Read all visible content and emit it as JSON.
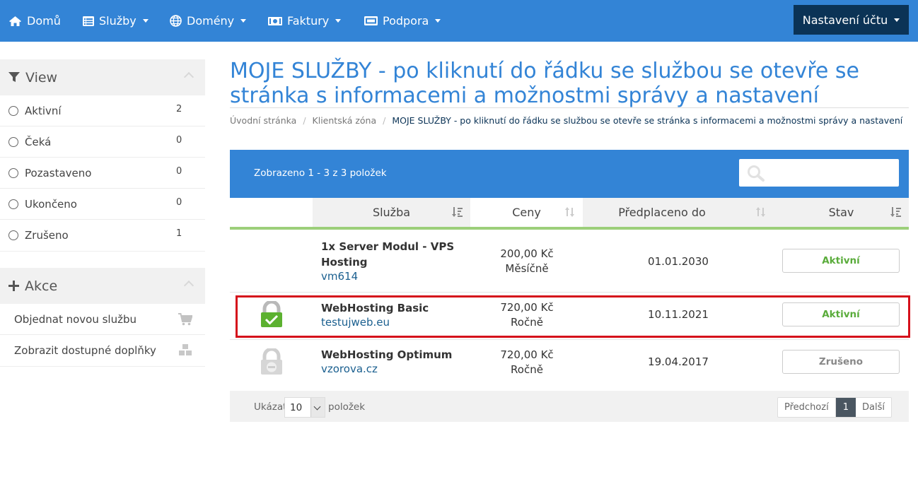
{
  "nav": {
    "home": "Domů",
    "services": "Služby",
    "domains": "Domény",
    "invoices": "Faktury",
    "support": "Podpora",
    "account": "Nastavení účtu"
  },
  "sidebar": {
    "view_title": "View",
    "filters": [
      {
        "label": "Aktivní",
        "count": "2"
      },
      {
        "label": "Čeká",
        "count": "0"
      },
      {
        "label": "Pozastaveno",
        "count": "0"
      },
      {
        "label": "Ukončeno",
        "count": "0"
      },
      {
        "label": "Zrušeno",
        "count": "1"
      }
    ],
    "actions_title": "Akce",
    "actions": [
      {
        "label": "Objednat novou službu",
        "icon": "cart-icon"
      },
      {
        "label": "Zobrazit dostupné doplňky",
        "icon": "cubes-icon"
      }
    ]
  },
  "page": {
    "title": "MOJE SLUŽBY - po kliknutí do řádku se službou se otevře se stránka s informacemi a možnostmi správy a nastavení",
    "breadcrumb": [
      "Úvodní stránka",
      "Klientská zóna",
      "MOJE SLUŽBY - po kliknutí do řádku se službou se otevře se stránka s informacemi a možnostmi správy a nastavení"
    ]
  },
  "table": {
    "shown_text": "Zobrazeno 1 - 3 z 3 položek",
    "search_placeholder": "",
    "headers": {
      "service": "Služba",
      "price": "Ceny",
      "paid_until": "Předplaceno do",
      "status": "Stav"
    },
    "rows": [
      {
        "name_line1": "1x Server Modul - VPS",
        "name_line2": "Hosting",
        "domain": "vm614",
        "price": "200,00 Kč",
        "cycle": "Měsíčně",
        "date": "01.01.2030",
        "status": "Aktivní",
        "icon": "none"
      },
      {
        "name_line1": "WebHosting Basic",
        "domain": "testujweb.eu",
        "price": "720,00 Kč",
        "cycle": "Ročně",
        "date": "10.11.2021",
        "status": "Aktivní",
        "icon": "lock-active-icon"
      },
      {
        "name_line1": "WebHosting Optimum",
        "domain": "vzorova.cz",
        "price": "720,00 Kč",
        "cycle": "Ročně",
        "date": "19.04.2017",
        "status": "Zrušeno",
        "icon": "lock-cancelled-icon"
      }
    ],
    "footer": {
      "show_label": "Ukázat",
      "per_page": "10",
      "items_label": "položek",
      "prev": "Předchozí",
      "current_page": "1",
      "next": "Další"
    }
  },
  "colors": {
    "brand_blue": "#3384d6",
    "dark_navy": "#0b3356",
    "accent_green": "#9ccf7a",
    "active_green": "#5aac3b",
    "highlight_red": "#d5101b"
  }
}
